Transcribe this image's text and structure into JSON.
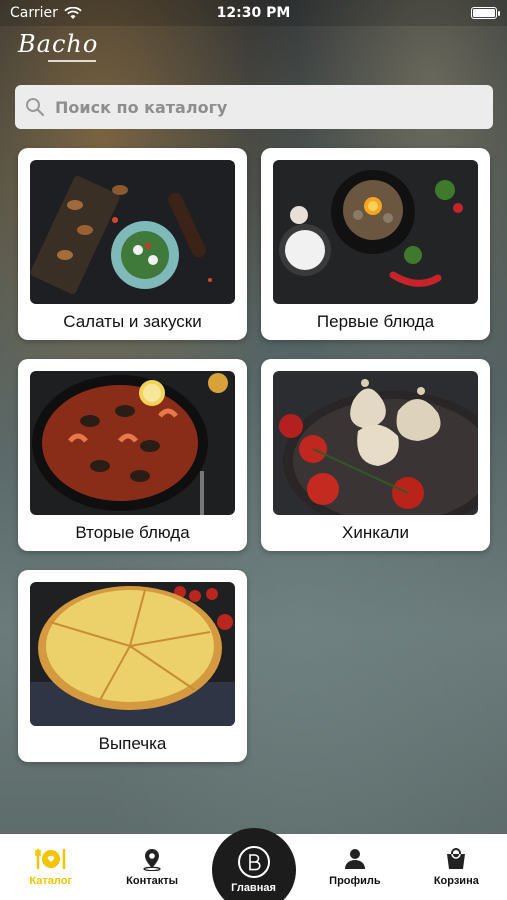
{
  "status_bar": {
    "carrier": "Carrier",
    "time": "12:30 PM"
  },
  "brand": {
    "logo_text": "Bacho"
  },
  "search": {
    "placeholder": "Поиск по каталогу"
  },
  "categories": [
    {
      "label": "Салаты  и закуски",
      "image": "salads-photo"
    },
    {
      "label": "Первые блюда",
      "image": "soup-photo"
    },
    {
      "label": "Вторые блюда",
      "image": "seafood-paella-photo"
    },
    {
      "label": "Хинкали",
      "image": "khinkali-photo"
    },
    {
      "label": "Выпечка",
      "image": "khachapuri-photo"
    }
  ],
  "tabbar": {
    "items": [
      {
        "label": "Каталог",
        "icon": "catalog-plate-icon",
        "active": true
      },
      {
        "label": "Контакты",
        "icon": "location-pin-icon",
        "active": false
      },
      {
        "label": "Главная",
        "icon": "bacho-logo-icon",
        "active": false
      },
      {
        "label": "Профиль",
        "icon": "person-icon",
        "active": false
      },
      {
        "label": "Корзина",
        "icon": "bag-icon",
        "active": false
      }
    ]
  },
  "colors": {
    "accent": "#f3c400",
    "tabbar_bg": "#ffffff",
    "center_button": "#1c1c1c",
    "card_bg": "#ffffff",
    "search_bg": "#ececec"
  }
}
